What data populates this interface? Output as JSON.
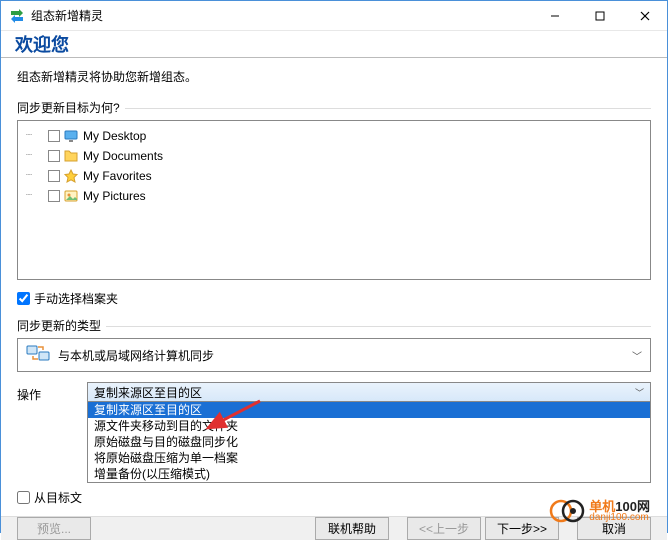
{
  "window": {
    "title": "组态新增精灵"
  },
  "header": {
    "welcome": "欢迎您"
  },
  "intro": "组态新增精灵将协助您新增组态。",
  "targets_label": "同步更新目标为何?",
  "tree": [
    {
      "label": "My Desktop",
      "icon": "desktop"
    },
    {
      "label": "My Documents",
      "icon": "documents"
    },
    {
      "label": "My Favorites",
      "icon": "favorites"
    },
    {
      "label": "My Pictures",
      "icon": "pictures"
    }
  ],
  "manual_select": {
    "checked": true,
    "label": "手动选择档案夹"
  },
  "sync_type_label": "同步更新的类型",
  "sync_type": {
    "text": "与本机或局域网络计算机同步"
  },
  "op_label": "操作",
  "dropdown": {
    "selected": "复制来源区至目的区",
    "options": [
      "复制来源区至目的区",
      "源文件夹移动到目的文件夹",
      "原始磁盘与目的磁盘同步化",
      "将原始磁盘压缩为单一档案",
      "增量备份(以压缩模式)"
    ]
  },
  "delete_checkbox": {
    "label_partial": "从目标文",
    "checked": false
  },
  "footer": {
    "preview": "预览...",
    "help": "联机帮助",
    "prev": "<<上一步",
    "next": "下一步>>",
    "cancel": "取消"
  },
  "watermark": {
    "brand_a": "单机",
    "brand_b": "100网",
    "url": "danji100.com"
  }
}
